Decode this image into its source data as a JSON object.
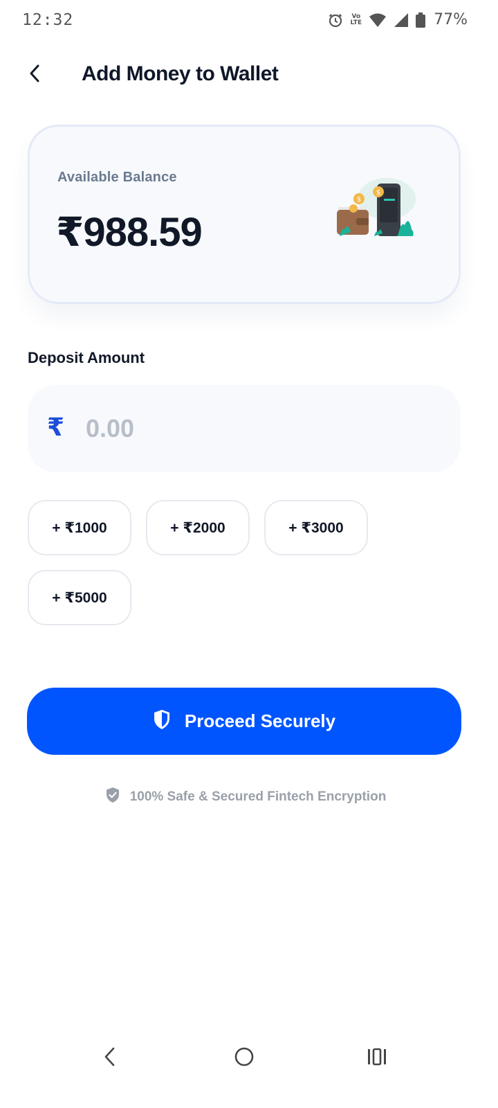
{
  "status_bar": {
    "time": "12:32",
    "battery_percent": "77%",
    "volte_line1": "Vo",
    "volte_line2": "LTE",
    "icons": [
      "alarm-icon",
      "volte-icon",
      "wifi-icon",
      "signal-icon",
      "battery-icon"
    ]
  },
  "header": {
    "title": "Add Money to Wallet",
    "back_icon": "chevron-left-icon"
  },
  "balance_card": {
    "label": "Available Balance",
    "amount": "₹988.59",
    "illustration": "wallet-phone-illustration"
  },
  "deposit": {
    "label": "Deposit Amount",
    "currency_symbol": "₹",
    "value": "",
    "placeholder": "0.00"
  },
  "quick_amounts": [
    "+ ₹1000",
    "+ ₹2000",
    "+ ₹3000",
    "+ ₹5000"
  ],
  "proceed": {
    "label": "Proceed Securely",
    "icon": "shield-icon"
  },
  "security_note": {
    "text": "100% Safe & Secured Fintech Encryption",
    "icon": "shield-check-icon"
  },
  "colors": {
    "primary": "#0055ff",
    "text_dark": "#0f172a",
    "muted": "#6b7a90",
    "card_bg": "#f7f9fc"
  },
  "nav": {
    "icons": [
      "nav-back-icon",
      "nav-home-icon",
      "nav-recents-icon"
    ]
  }
}
